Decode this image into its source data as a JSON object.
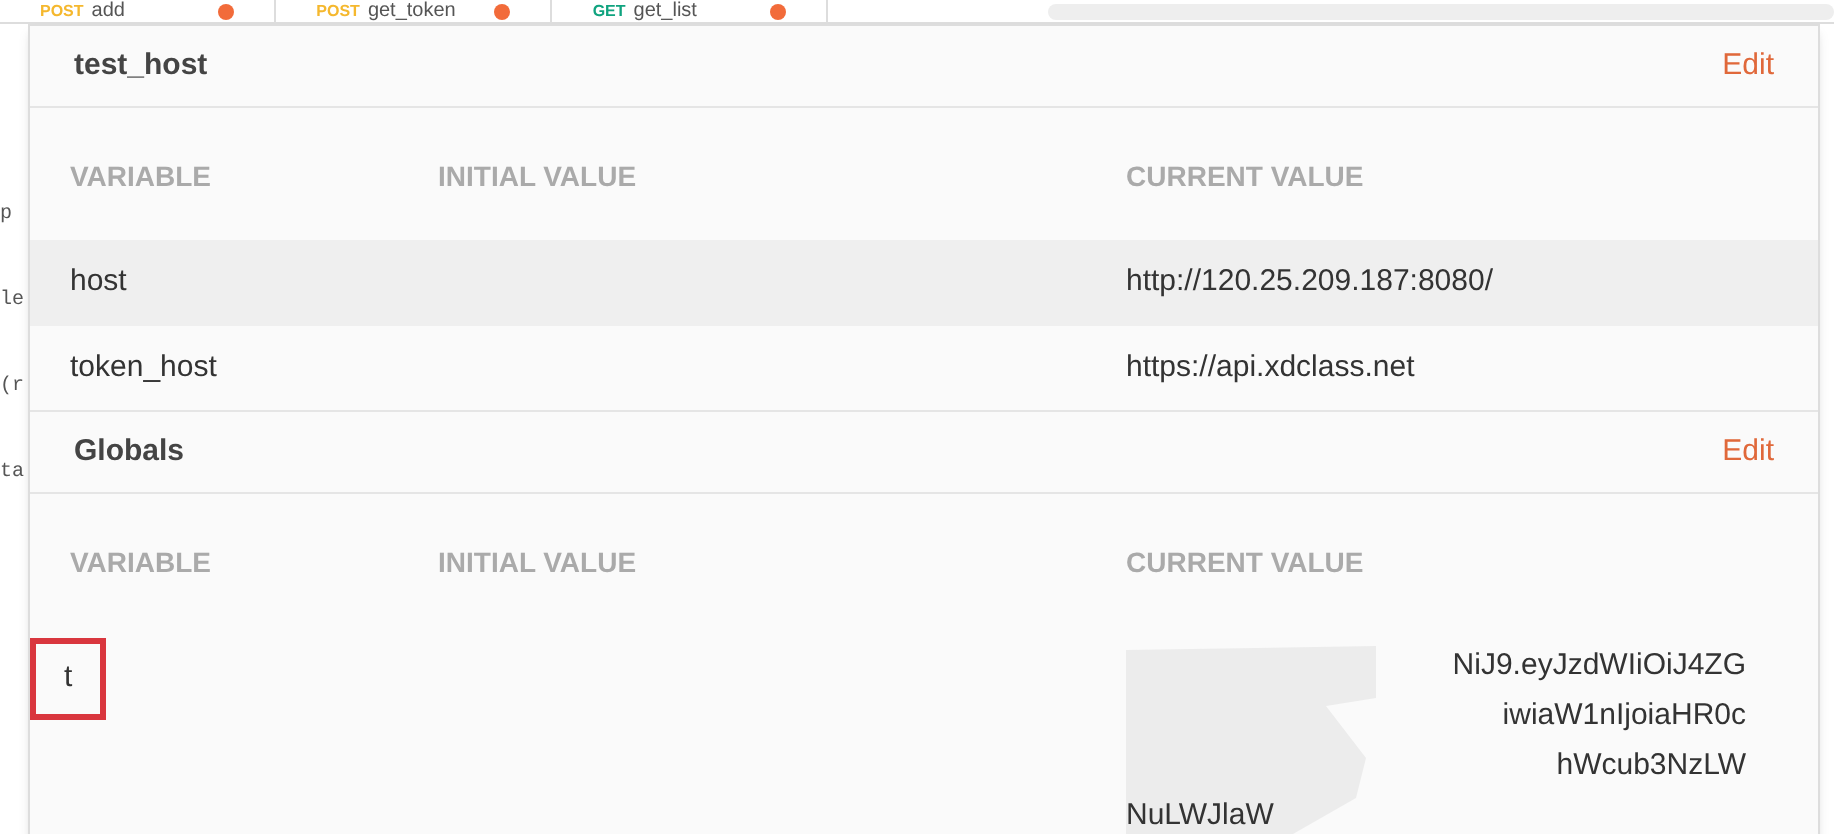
{
  "tabs": [
    {
      "method": "POST",
      "name": "add",
      "unsaved": true
    },
    {
      "method": "POST",
      "name": "get_token",
      "unsaved": true
    },
    {
      "method": "GET",
      "name": "get_list",
      "unsaved": true
    }
  ],
  "left_fragments": [
    "p",
    "le",
    "(r",
    "ta"
  ],
  "sections": [
    {
      "title": "test_host",
      "edit": "Edit",
      "columns": [
        "VARIABLE",
        "INITIAL VALUE",
        "CURRENT VALUE"
      ],
      "rows": [
        {
          "variable": "host",
          "initial": "",
          "current": [
            "http://120.25.209.187:8080/"
          ],
          "hovered": true,
          "outlined": false,
          "redacted": false
        },
        {
          "variable": "token_host",
          "initial": "",
          "current": [
            "https://api.xdclass.net"
          ],
          "hovered": false,
          "outlined": false,
          "redacted": false
        }
      ]
    },
    {
      "title": "Globals",
      "edit": "Edit",
      "columns": [
        "VARIABLE",
        "INITIAL VALUE",
        "CURRENT VALUE"
      ],
      "rows": [
        {
          "variable": "t",
          "initial": "",
          "current": [
            "NiJ9.eyJzdWIiOiJ4ZG",
            "iwiaW1nIjoiaHR0c",
            "hWcub3NzLW",
            "NuLWJlaW"
          ],
          "hovered": false,
          "outlined": true,
          "redacted": true
        }
      ]
    }
  ]
}
